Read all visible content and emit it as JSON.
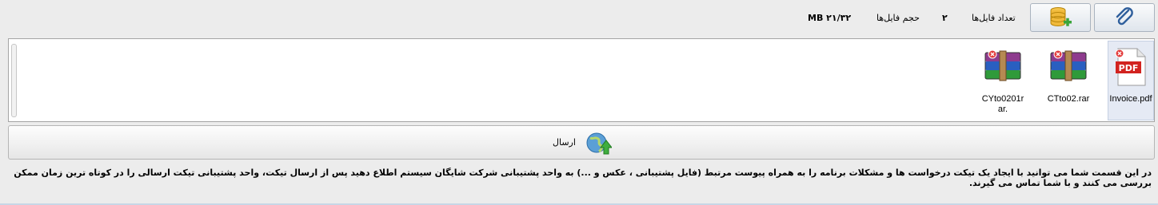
{
  "toolbar": {
    "attach_icon": "paperclip-icon",
    "add_db_icon": "database-add-icon",
    "file_count_label": "تعداد فایل‌ها",
    "file_count_value": "۲",
    "file_size_label": "حجم فایل‌ها",
    "file_size_value": "MB ۲۱/۳۲"
  },
  "files": [
    {
      "name": "Invoice.pdf",
      "icon": "pdf-file-icon",
      "selected": true
    },
    {
      "name": "CTto02.rar",
      "icon": "rar-archive-icon",
      "selected": false
    },
    {
      "name": "CYto0201rar.",
      "icon": "rar-archive-icon",
      "selected": false
    }
  ],
  "send_button": {
    "label": "ارسال",
    "icon": "globe-upload-icon"
  },
  "description": "در این قسمت شما می توانید با ایجاد یک تیکت درخواست ها و مشکلات برنامه را به همراه پیوست مرتبط (فایل پشتیبانی ، عکس و ...) به واحد پشتیبانی شرکت شایگان سیستم اطلاع دهید پس از ارسال تیکت، واحد پشتیبانی تیکت ارسالی را در کوتاه ترین زمان ممکن بررسی می کنند و با شما تماس می گیرند.",
  "colors": {
    "accent": "#a9b3bf",
    "selected_item_bg": "#e5eaf4",
    "background": "#ececec"
  }
}
